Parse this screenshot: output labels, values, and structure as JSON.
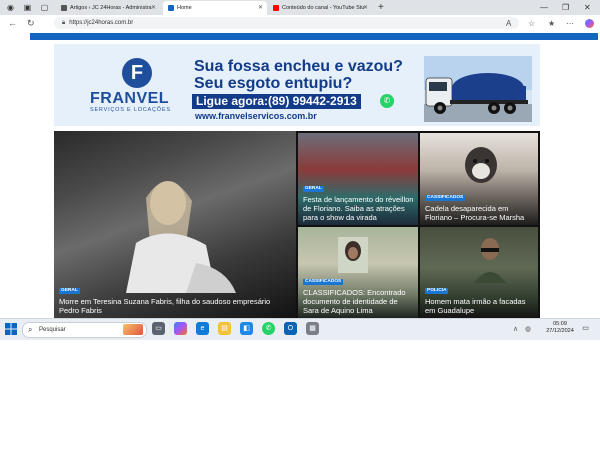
{
  "browser": {
    "tabs": [
      {
        "label": "Artigos ‹ JC 24Horas - Administra",
        "active": false,
        "favicon_color": "#555555"
      },
      {
        "label": "Home",
        "active": true,
        "favicon_color": "#1565c0"
      },
      {
        "label": "Conteúdo do canal - YouTube Stu",
        "active": false,
        "favicon_color": "#ff0000"
      }
    ],
    "new_tab": "+",
    "url": "https://jc24horas.com.br"
  },
  "ad": {
    "brand": "FRANVEL",
    "brand_letter": "F",
    "brand_sub": "SERVIÇOS E LOCAÇÕES",
    "headline_1": "Sua fossa encheu e vazou?",
    "headline_2": "Seu esgoto entupiu?",
    "phone": "Ligue agora:(89) 99442-2913",
    "website": "www.franvelservicos.com.br"
  },
  "news": [
    {
      "category": "GERAL",
      "title": "Morre em Teresina Suzana Fabris, filha do saudoso empresário Pedro Fabris"
    },
    {
      "category": "GERAL",
      "title": "Festa de lançamento do réveillon de Floriano. Saiba as atrações para o show da virada"
    },
    {
      "category": "CASSIFICADOS",
      "title": "Cadela desaparecida em Floriano – Procura-se Marsha"
    },
    {
      "category": "CASSIFICADOS",
      "title": "CLASSIFICADOS: Encontrado documento de identidade de Sara de Aquino Lima"
    },
    {
      "category": "POLICIA",
      "title": "Homem mata irmão a facadas em Guadalupe"
    }
  ],
  "taskbar": {
    "search_placeholder": "Pesquisar",
    "time": "05:09",
    "date": "27/12/2024"
  },
  "colors": {
    "accent": "#1565c0",
    "badge": "#1976d2",
    "brand": "#123b8a"
  }
}
